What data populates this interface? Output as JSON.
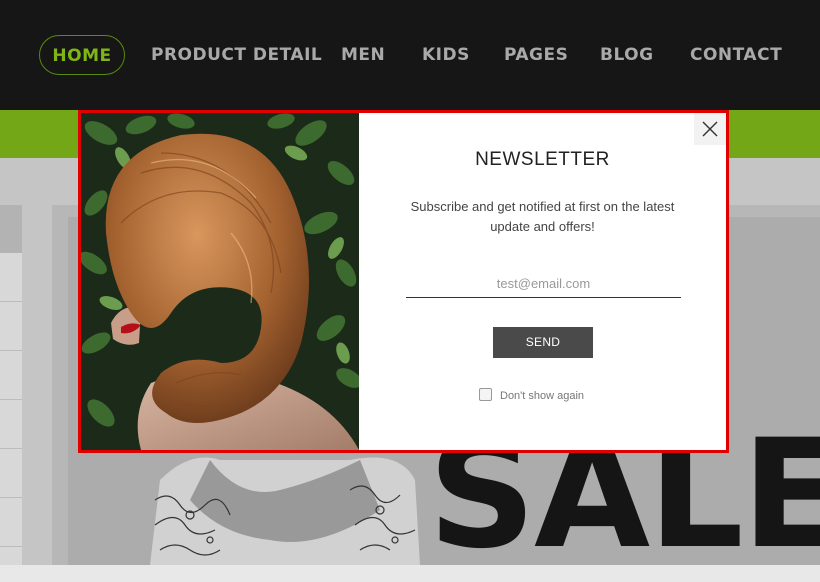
{
  "nav": {
    "items": [
      {
        "label": "HOME",
        "active": true
      },
      {
        "label": "PRODUCT DETAIL"
      },
      {
        "label": "MEN"
      },
      {
        "label": "KIDS"
      },
      {
        "label": "PAGES"
      },
      {
        "label": "BLOG"
      },
      {
        "label": "CONTACT"
      }
    ]
  },
  "background": {
    "banner_text": "SALE"
  },
  "newsletter": {
    "title": "NEWSLETTER",
    "description": "Subscribe and get notified at first on the latest update and offers!",
    "email_placeholder": "test@email.com",
    "send_label": "SEND",
    "dont_show_label": "Don't show again"
  },
  "colors": {
    "nav_bg": "#161616",
    "accent_green": "#7cb713",
    "modal_border": "#e00000",
    "send_bg": "#4a4a4a"
  }
}
